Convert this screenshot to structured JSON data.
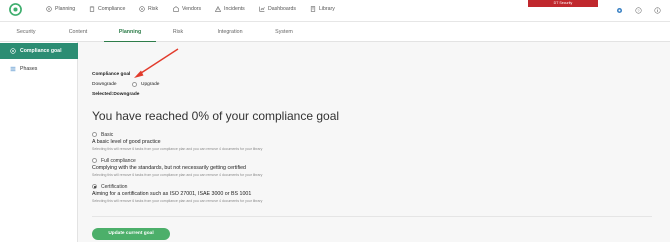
{
  "nav": {
    "items": [
      {
        "label": "Planning",
        "icon": "compass-icon"
      },
      {
        "label": "Compliance",
        "icon": "clipboard-icon"
      },
      {
        "label": "Risk",
        "icon": "risk-icon"
      },
      {
        "label": "Vendors",
        "icon": "vendors-icon"
      },
      {
        "label": "Incidents",
        "icon": "warning-icon"
      },
      {
        "label": "Dashboards",
        "icon": "chart-icon"
      },
      {
        "label": "Library",
        "icon": "book-icon"
      }
    ],
    "tenant_badge": "DT Security",
    "icons": [
      "gear-icon",
      "help-icon",
      "info-icon"
    ]
  },
  "tabs": [
    "Security",
    "Content",
    "Planning",
    "Risk",
    "Integration",
    "System"
  ],
  "active_tab": "Planning",
  "sidebar": {
    "items": [
      {
        "label": "Compliance goal",
        "icon": "target-icon"
      },
      {
        "label": "Phases",
        "icon": "list-icon"
      }
    ]
  },
  "goal": {
    "section_label": "Compliance goal",
    "downgrade_label": "Downgrade",
    "upgrade_label": "Upgrade",
    "selected_text": "Selected:Downgrade",
    "headline": "You have reached 0% of your compliance goal",
    "options": [
      {
        "title": "Basic",
        "description": "A basic level of good practice",
        "note": "Selecting this will remove 6 tasks from your compliance plan and you can remove 4 documents for your library",
        "checked": false
      },
      {
        "title": "Full compliance",
        "description": "Complying with the standards, but not necessarily getting certified",
        "note": "Selecting this will remove 6 tasks from your compliance plan and you can remove 4 documents for your library",
        "checked": false
      },
      {
        "title": "Certification",
        "description": "Aiming for a certification such as ISO 27001, ISAE 3000 or BS 1001",
        "note": "Selecting this will remove 6 tasks from your compliance plan and you can remove 4 documents for your library",
        "checked": true
      }
    ],
    "update_button": "Update current goal"
  },
  "colors": {
    "accent": "#2c8d73",
    "button": "#4caf6a",
    "badge": "#c0282d",
    "arrow": "#e23b2c"
  }
}
